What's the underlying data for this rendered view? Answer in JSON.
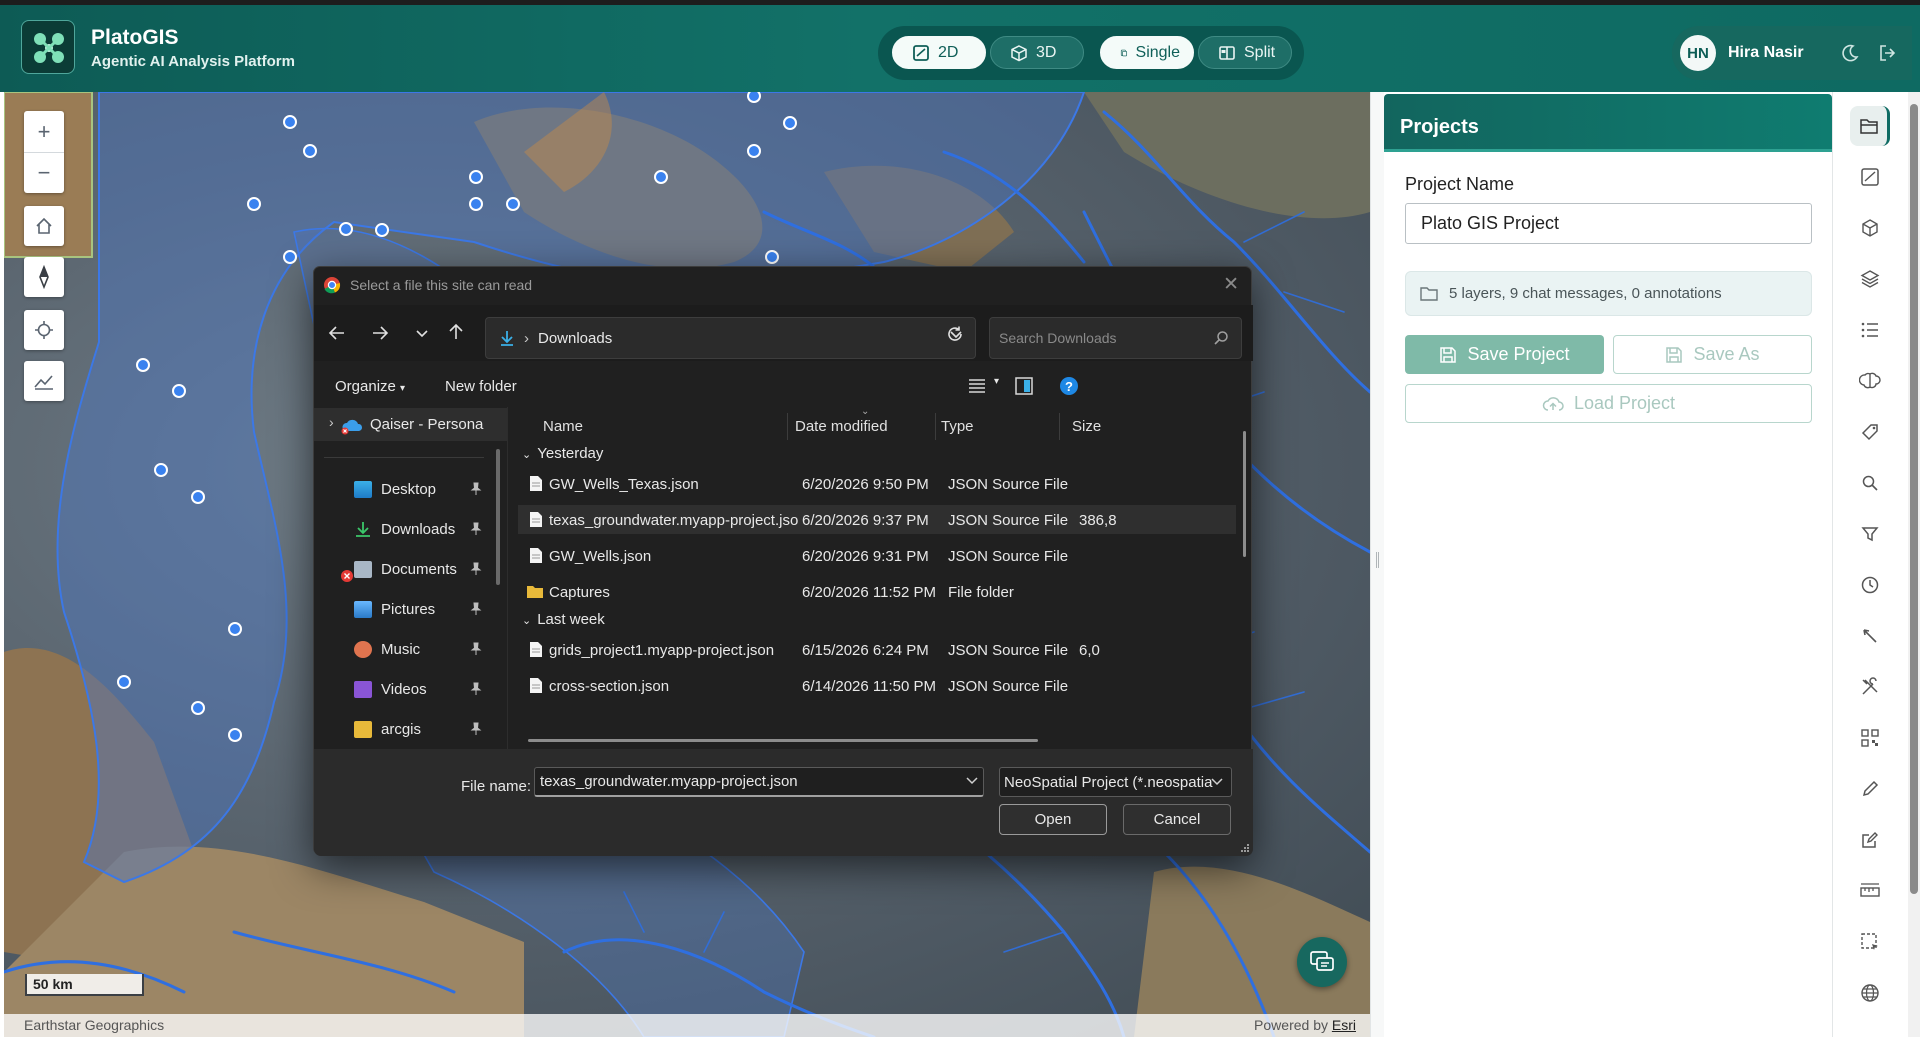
{
  "header": {
    "app_name": "PlatoGIS",
    "app_subtitle": "Agentic AI Analysis Platform",
    "modes": [
      {
        "label": "2D",
        "icon": "map-2d-icon",
        "active": true
      },
      {
        "label": "3D",
        "icon": "cube-icon",
        "active": false
      },
      {
        "label": "Single",
        "icon": "single-view-icon",
        "active": true
      },
      {
        "label": "Split",
        "icon": "split-view-icon",
        "active": false
      }
    ],
    "user_initials": "HN",
    "user_name": "Hira Nasir"
  },
  "map": {
    "scale_label": "50 km",
    "attribution_left": "Earthstar Geographics",
    "attribution_powered": "Powered by ",
    "attribution_link": "Esri"
  },
  "projects": {
    "title": "Projects",
    "name_label": "Project Name",
    "name_value": "Plato GIS Project",
    "summary": "5 layers, 9 chat messages, 0 annotations",
    "save_label": "Save Project",
    "save_as_label": "Save As",
    "load_label": "Load Project"
  },
  "dialog": {
    "title": "Select a file this site can read",
    "location": "Downloads",
    "search_placeholder": "Search Downloads",
    "organize_label": "Organize",
    "new_folder_label": "New folder",
    "nav_items": [
      {
        "label": "Qaiser - Persona",
        "icon": "onedrive-icon"
      },
      {
        "label": "Desktop",
        "icon": "desktop-icon"
      },
      {
        "label": "Downloads",
        "icon": "download-icon"
      },
      {
        "label": "Documents",
        "icon": "documents-icon"
      },
      {
        "label": "Pictures",
        "icon": "pictures-icon"
      },
      {
        "label": "Music",
        "icon": "music-icon"
      },
      {
        "label": "Videos",
        "icon": "videos-icon"
      },
      {
        "label": "arcgis",
        "icon": "folder-icon"
      }
    ],
    "columns": {
      "name": "Name",
      "date": "Date modified",
      "type": "Type",
      "size": "Size"
    },
    "groups": [
      {
        "label": "Yesterday",
        "files": [
          {
            "name": "GW_Wells_Texas.json",
            "date": "6/20/2026 9:50 PM",
            "type": "JSON Source File",
            "size": ""
          },
          {
            "name": "texas_groundwater.myapp-project.json",
            "date": "6/20/2026 9:37 PM",
            "type": "JSON Source File",
            "size": "386,8"
          },
          {
            "name": "GW_Wells.json",
            "date": "6/20/2026 9:31 PM",
            "type": "JSON Source File",
            "size": ""
          },
          {
            "name": "Captures",
            "date": "6/20/2026 11:52 PM",
            "type": "File folder",
            "size": ""
          }
        ]
      },
      {
        "label": "Last week",
        "files": [
          {
            "name": "grids_project1.myapp-project.json",
            "date": "6/15/2026 6:24 PM",
            "type": "JSON Source File",
            "size": "6,0"
          },
          {
            "name": "cross-section.json",
            "date": "6/14/2026 11:50 PM",
            "type": "JSON Source File",
            "size": ""
          }
        ]
      }
    ],
    "file_name_label": "File name:",
    "file_name_value": "texas_groundwater.myapp-project.json",
    "file_type": "NeoSpatial Project (*.neospatia",
    "open_label": "Open",
    "cancel_label": "Cancel"
  },
  "colors": {
    "brand": "#0f6b63",
    "water": "#2f6fe0",
    "dialog_bg": "#202020"
  }
}
